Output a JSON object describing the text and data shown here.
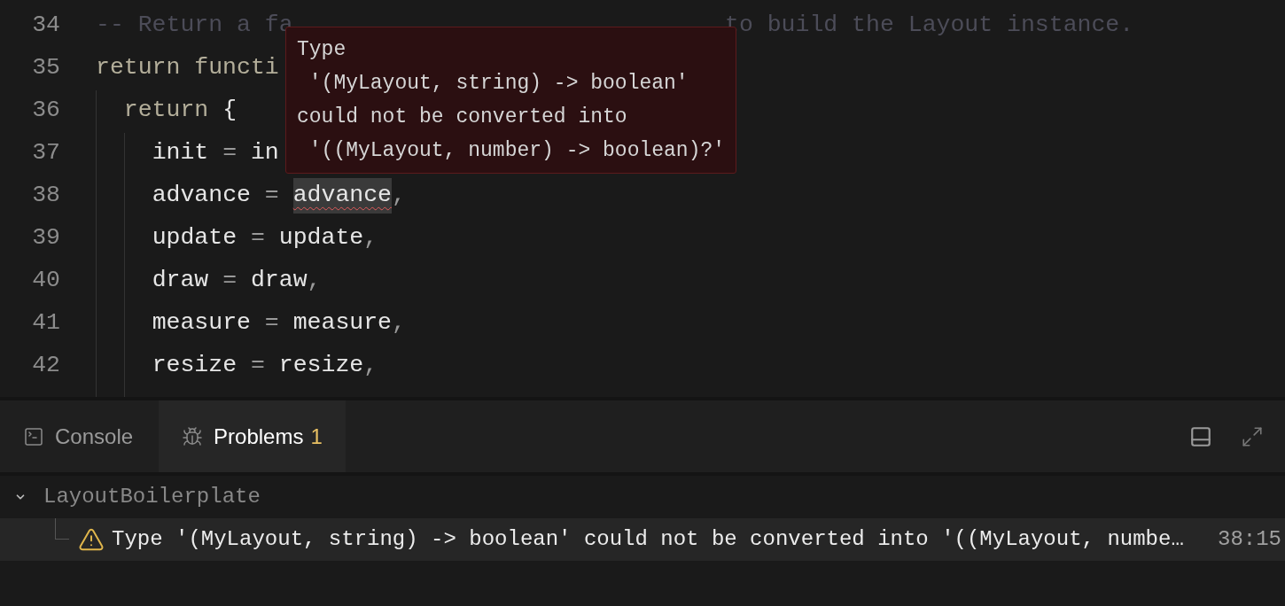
{
  "editor": {
    "lines": [
      {
        "number": "34",
        "tokens": [
          {
            "text": "-- Return a fa",
            "kind": "comment"
          }
        ],
        "after": [
          {
            "text": "to build the Layout instance.",
            "kind": "comment"
          }
        ]
      },
      {
        "number": "35",
        "tokens": [
          {
            "text": "return functi",
            "kind": "keyword"
          }
        ]
      },
      {
        "number": "36",
        "tokens": [
          {
            "text": "  return",
            "kind": "keyword"
          },
          {
            "text": " {",
            "kind": "ident"
          }
        ]
      },
      {
        "number": "37",
        "tokens": [
          {
            "text": "    init",
            "kind": "ident"
          },
          {
            "text": " = ",
            "kind": "punct"
          },
          {
            "text": "in",
            "kind": "ident"
          }
        ]
      },
      {
        "number": "38",
        "tokens": [
          {
            "text": "    advance",
            "kind": "ident"
          },
          {
            "text": " = ",
            "kind": "punct"
          },
          {
            "text": "advance",
            "kind": "error"
          },
          {
            "text": ",",
            "kind": "punct"
          }
        ]
      },
      {
        "number": "39",
        "tokens": [
          {
            "text": "    update",
            "kind": "ident"
          },
          {
            "text": " = ",
            "kind": "punct"
          },
          {
            "text": "update",
            "kind": "ident"
          },
          {
            "text": ",",
            "kind": "punct"
          }
        ]
      },
      {
        "number": "40",
        "tokens": [
          {
            "text": "    draw",
            "kind": "ident"
          },
          {
            "text": " = ",
            "kind": "punct"
          },
          {
            "text": "draw",
            "kind": "ident"
          },
          {
            "text": ",",
            "kind": "punct"
          }
        ]
      },
      {
        "number": "41",
        "tokens": [
          {
            "text": "    measure",
            "kind": "ident"
          },
          {
            "text": " = ",
            "kind": "punct"
          },
          {
            "text": "measure",
            "kind": "ident"
          },
          {
            "text": ",",
            "kind": "punct"
          }
        ]
      },
      {
        "number": "42",
        "tokens": [
          {
            "text": "    resize",
            "kind": "ident"
          },
          {
            "text": " = ",
            "kind": "punct"
          },
          {
            "text": "resize",
            "kind": "ident"
          },
          {
            "text": ",",
            "kind": "punct"
          }
        ]
      }
    ],
    "tooltip": {
      "lines": [
        "Type",
        " '(MyLayout, string) -> boolean'",
        "could not be converted into",
        " '((MyLayout, number) -> boolean)?'"
      ]
    }
  },
  "panel": {
    "tabs": [
      {
        "label": "Console",
        "selected": false
      },
      {
        "label": "Problems",
        "count": "1",
        "selected": true
      }
    ],
    "tree": [
      {
        "label": "LayoutBoilerplate",
        "expanded": true,
        "children": [
          {
            "message": "Type '(MyLayout, string) -> boolean' could not be converted into '((MyLayout, numbe…",
            "location": "38:15",
            "selected": true
          }
        ]
      }
    ]
  }
}
